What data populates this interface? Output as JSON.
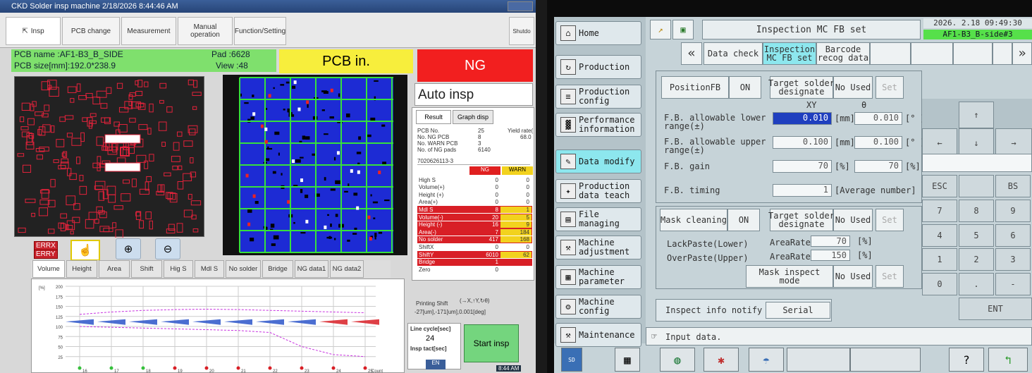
{
  "left": {
    "window_title": "CKD Solder insp machine    2/18/2026 8:44:46 AM",
    "toolbar": [
      "Insp",
      "PCB change",
      "Measurement",
      "Manual operation",
      "Function/Setting"
    ],
    "shutdown_label": "Shutdo",
    "pcb_name": "PCB name :AF1-B3_B_SIDE",
    "pcb_size": "PCB size[mm]:192.0*238.9",
    "pad": "Pad :6628",
    "view": "View :48",
    "status": "PCB in.",
    "result": "NG",
    "mode": "Auto insp",
    "result_tabs": [
      "Result",
      "Graph disp"
    ],
    "summary": [
      {
        "label": "PCB No.",
        "value": "25"
      },
      {
        "label": "No. NG PCB",
        "value": "8"
      },
      {
        "label": "No. WARN PCB",
        "value": "3"
      },
      {
        "label": "No. of NG pads",
        "value": "6140"
      }
    ],
    "yield_label": "Yield rate(",
    "yield_value": "68.0",
    "board_id": "7020626113-3",
    "col_ng": "NG",
    "col_warn": "WARN",
    "rows": [
      {
        "name": "High S",
        "ng": "0",
        "warn": "0",
        "hl": false
      },
      {
        "name": "Volume(+)",
        "ng": "0",
        "warn": "0",
        "hl": false
      },
      {
        "name": "Height (+)",
        "ng": "0",
        "warn": "0",
        "hl": false
      },
      {
        "name": "Area(+)",
        "ng": "0",
        "warn": "0",
        "hl": false
      },
      {
        "name": "Mdl S",
        "ng": "8",
        "warn": "1",
        "hl": true
      },
      {
        "name": "Volume(-)",
        "ng": "20",
        "warn": "5",
        "hl": true
      },
      {
        "name": "Height (-)",
        "ng": "16",
        "warn": "9",
        "hl": true
      },
      {
        "name": "Area(-)",
        "ng": "7",
        "warn": "184",
        "hl": true
      },
      {
        "name": "No solder",
        "ng": "417",
        "warn": "168",
        "hl": true
      },
      {
        "name": "ShiftX",
        "ng": "0",
        "warn": "0",
        "hl": false
      },
      {
        "name": "ShiftY",
        "ng": "6010",
        "warn": "62",
        "hl": true
      },
      {
        "name": "Bridge",
        "ng": "1",
        "warn": "",
        "hl": true
      },
      {
        "name": "Zero",
        "ng": "0",
        "warn": "",
        "hl": false
      }
    ],
    "printing_shift_label": "Printing Shift",
    "printing_shift_axes": "(→X,↑Y,↻θ)",
    "printing_shift_value": "-27[um],-171[um],0.001[deg]",
    "line_cycle_label": "Line cycle[sec]",
    "line_cycle_value": "24",
    "insp_tact_label": "Insp tact[sec]",
    "start_label": "Start insp",
    "tags": [
      "ERRX",
      "ERRY"
    ],
    "graph_tabs": [
      "Volume",
      "Height",
      "Area",
      "Shift",
      "Hig S",
      "Mdl S",
      "No solder",
      "Bridge",
      "NG data1",
      "NG data2"
    ],
    "graph_unit": "[%]",
    "y_ticks": [
      "200",
      "175",
      "150",
      "125",
      "100",
      "75",
      "50",
      "25"
    ],
    "x_label": "Count",
    "x_points": [
      "16",
      "17",
      "18",
      "19",
      "20",
      "21",
      "22",
      "23",
      "24",
      "25"
    ],
    "clock": "8:44 AM",
    "lang": "EN"
  },
  "right": {
    "title": "Inspection MC FB set",
    "datetime": "2026. 2.18 09:49:30",
    "board": "AF1-B3_B-side#3",
    "sidebar": [
      {
        "label": "Home",
        "icon": "home-icon",
        "glyph": "⌂",
        "sel": false
      },
      {
        "label": "Production",
        "icon": "production-icon",
        "glyph": "↻",
        "sel": false
      },
      {
        "label": "Production\nconfig",
        "icon": "config-icon",
        "glyph": "≡",
        "sel": false
      },
      {
        "label": "Performance\ninformation",
        "icon": "chart-icon",
        "glyph": "▓",
        "sel": false
      },
      {
        "label": "Data modify",
        "icon": "pencil-icon",
        "glyph": "✎",
        "sel": true
      },
      {
        "label": "Production\ndata teach",
        "icon": "teach-icon",
        "glyph": "✦",
        "sel": false
      },
      {
        "label": "File\nmanaging",
        "icon": "file-icon",
        "glyph": "▤",
        "sel": false
      },
      {
        "label": "Machine\nadjustment",
        "icon": "wrench-icon",
        "glyph": "⚒",
        "sel": false
      },
      {
        "label": "Machine\nparameter",
        "icon": "parameter-icon",
        "glyph": "▦",
        "sel": false
      },
      {
        "label": "Machine\nconfig",
        "icon": "machine-config-icon",
        "glyph": "⚙",
        "sel": false
      },
      {
        "label": "Maintenance",
        "icon": "maintenance-icon",
        "glyph": "⚒",
        "sel": false
      }
    ],
    "tabs": [
      "Data check",
      "Inspection\nMC FB set",
      "Barcode\nrecog data"
    ],
    "position_fb": "PositionFB",
    "position_fb_state": "ON",
    "target_solder": "Target solder\ndesignate",
    "no_used": "No Used",
    "set": "Set",
    "col_xy": "XY",
    "col_theta": "θ",
    "lower_label": "F.B. allowable lower\nrange(±)",
    "lower_xy": "0.010",
    "lower_theta": "0.010",
    "upper_label": "F.B. allowable upper\nrange(±)",
    "upper_xy": "0.100",
    "upper_theta": "0.100",
    "unit_mm": "[mm]",
    "unit_deg": "[° ]",
    "gain_label": "F.B. gain",
    "gain_xy": "70",
    "gain_theta": "70",
    "unit_pct": "[%]",
    "timing_label": "F.B. timing",
    "timing_value": "1",
    "timing_unit": "[Average number]",
    "mask_cleaning": "Mask cleaning",
    "mask_state": "ON",
    "lackpaste": "LackPaste(Lower)",
    "overpaste": "OverPaste(Upper)",
    "arearate": "AreaRate",
    "lack_value": "70",
    "over_value": "150",
    "mask_inspect": "Mask inspect mode",
    "inspect_info": "Inspect info notify",
    "serial": "Serial",
    "status_msg": "Input data.",
    "keys": [
      "ESC",
      "",
      "BS",
      "7",
      "8",
      "9",
      "4",
      "5",
      "6",
      "1",
      "2",
      "3",
      "0",
      ".",
      "-"
    ],
    "ent": "ENT",
    "arrow_up": "↑",
    "arrow_down": "↓",
    "arrow_left": "←",
    "arrow_right": "→",
    "sd": "SD"
  }
}
